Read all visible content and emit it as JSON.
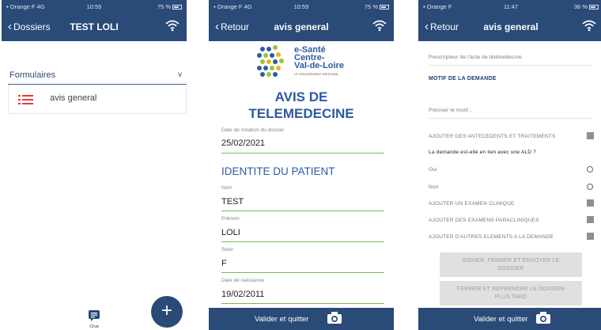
{
  "screen1": {
    "status": {
      "carrier": "Orange F 4G",
      "time": "10:55",
      "battery": "75 %"
    },
    "nav": {
      "back_label": "Dossiers",
      "title": "TEST LOLI"
    },
    "section_label": "Formulaires",
    "section_chevron": "v",
    "items": [
      {
        "label": "avis general",
        "icon": "list-icon"
      }
    ],
    "fab_label": "+",
    "chat_label": "Chat"
  },
  "screen2": {
    "status": {
      "carrier": "Orange F 4G",
      "time": "10:59",
      "battery": "75 %"
    },
    "nav": {
      "back_label": "Retour",
      "title": "avis general"
    },
    "logo": {
      "line1": "e-Santé",
      "line2": "Centre-",
      "line3": "Val-de-Loire",
      "tagline": "LE GROUPEMENT RÉGIONAL"
    },
    "title_line1": "AVIS DE",
    "title_line2": "TELEMEDECINE",
    "fields_top": [
      {
        "label": "Date de création du dossier",
        "value": "25/02/2021"
      }
    ],
    "section_title": "IDENTITE DU PATIENT",
    "fields": [
      {
        "label": "Nom",
        "value": "TEST"
      },
      {
        "label": "Prénom",
        "value": "LOLI"
      },
      {
        "label": "Sexe",
        "value": "F"
      },
      {
        "label": "Date de naissance",
        "value": "19/02/2011"
      }
    ],
    "bottom_button": "Valider et quitter"
  },
  "screen3": {
    "status": {
      "carrier": "Orange F",
      "time": "11:47",
      "battery": "36 %"
    },
    "nav": {
      "back_label": "Retour",
      "title": "avis general"
    },
    "prescripteur": "Prescripteur de l'acte de télémédecine",
    "motif_title": "MOTIF DE LA DEMANDE",
    "motif_placeholder": "Préciser le motif...",
    "antecedents": "AJOUTER DES ANTECEDENTS ET TRAITEMENTS",
    "ald_question": "La demande est-elle en lien avec une ALD ?",
    "oui": "Oui",
    "non": "Non",
    "examen_clinique": "AJOUTER UN EXAMEN CLINIQUE",
    "examens_paracliniques": "AJOUTER DES EXAMENS PARACLINIQUES",
    "autres_elements": "AJOUTER D'AUTRES ELEMENTS A LA DEMANDE",
    "signer_line1": "SIGNER, FERMER ET ENVOYER LE",
    "signer_line2": "DOSSIER",
    "fermer_line1": "FERMER ET REPRENDRE LE DOSSIER",
    "fermer_line2": "PLUS TARD",
    "bottom_button": "Valider et quitter"
  }
}
